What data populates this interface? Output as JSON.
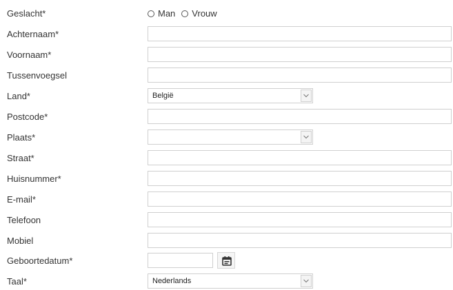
{
  "form": {
    "gender": {
      "label": "Geslacht*",
      "options": [
        {
          "label": "Man"
        },
        {
          "label": "Vrouw"
        }
      ]
    },
    "last_name": {
      "label": "Achternaam*",
      "value": ""
    },
    "first_name": {
      "label": "Voornaam*",
      "value": ""
    },
    "infix": {
      "label": "Tussenvoegsel",
      "value": ""
    },
    "country": {
      "label": "Land*",
      "selected": "België"
    },
    "postcode": {
      "label": "Postcode*",
      "value": ""
    },
    "city": {
      "label": "Plaats*",
      "selected": ""
    },
    "street": {
      "label": "Straat*",
      "value": ""
    },
    "house_number": {
      "label": "Huisnummer*",
      "value": ""
    },
    "email": {
      "label": "E-mail*",
      "value": ""
    },
    "phone": {
      "label": "Telefoon",
      "value": ""
    },
    "mobile": {
      "label": "Mobiel",
      "value": ""
    },
    "birthdate": {
      "label": "Geboortedatum*",
      "value": "",
      "icon": "calendar-icon"
    },
    "language": {
      "label": "Taal*",
      "selected": "Nederlands"
    }
  }
}
